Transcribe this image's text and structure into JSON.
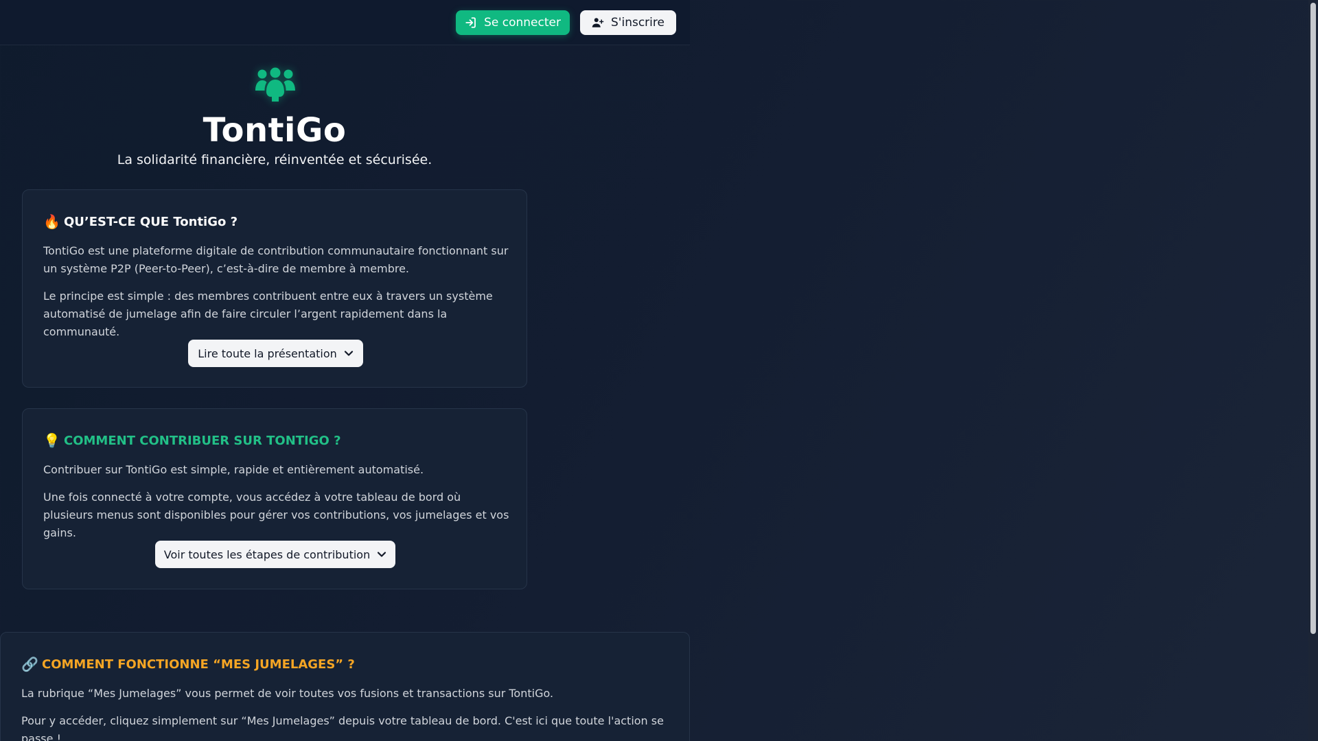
{
  "header": {
    "login_label": "Se connecter",
    "signup_label": "S'inscrire"
  },
  "hero": {
    "title": "TontiGo",
    "subtitle": "La solidarité financière, réinventée et sécurisée."
  },
  "cards": [
    {
      "emoji": "🔥",
      "heading": "QU’EST-CE QUE TontiGo ?",
      "paragraphs": [
        "TontiGo est une plateforme digitale de contribution communautaire fonctionnant sur un système P2P (Peer-to-Peer), c’est-à-dire de membre à membre.",
        "Le principe est simple : des membres contribuent entre eux à travers un système automatisé de jumelage afin de faire circuler l’argent rapidement dans la communauté."
      ],
      "button_label": "Lire toute la présentation"
    },
    {
      "emoji": "💡",
      "heading": "COMMENT CONTRIBUER SUR TONTIGO ?",
      "paragraphs": [
        "Contribuer sur TontiGo est simple, rapide et entièrement automatisé.",
        "Une fois connecté à votre compte, vous accédez à votre tableau de bord où plusieurs menus sont disponibles pour gérer vos contributions, vos jumelages et vos gains."
      ],
      "button_label": "Voir toutes les étapes de contribution"
    },
    {
      "emoji": "🔗",
      "heading": "COMMENT FONCTIONNE “MES JUMELAGES” ?",
      "paragraphs": [
        "La rubrique “Mes Jumelages” vous permet de voir toutes vos fusions et transactions sur TontiGo.",
        "Pour y accéder, cliquez simplement sur “Mes Jumelages” depuis votre tableau de bord. C'est ici que toute l'action se passe !"
      ]
    }
  ],
  "colors": {
    "accent_green": "#10b981",
    "heading_green": "#22c087",
    "heading_orange": "#f5a524",
    "background": "#0f1b2d",
    "card": "#162235"
  },
  "icons": {
    "login": "sign-in-icon",
    "signup": "user-plus-icon",
    "logo": "users-icon",
    "chevron": "chevron-down-icon"
  }
}
